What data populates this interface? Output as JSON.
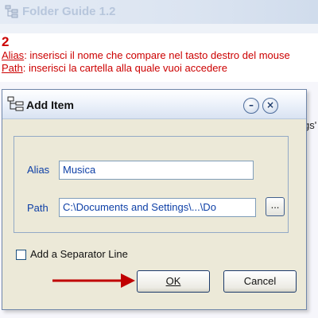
{
  "app": {
    "title": "Folder Guide 1.2"
  },
  "instructions": {
    "step": "2",
    "alias_term": "Alias",
    "alias_text": ": inserisci il nome che compare nel tasto destro del mouse",
    "path_term": "Path",
    "path_text": ": inserisci la cartella alla quale vuoi accedere"
  },
  "background": {
    "clipped_text": "gs'"
  },
  "dialog": {
    "title": "Add Item",
    "alias_label": "Alias",
    "alias_value": "Musica",
    "path_label": "Path",
    "path_value": "C:\\Documents and Settings\\...\\Do",
    "browse_label": "...",
    "separator_label": "Add a Separator Line",
    "separator_checked": false,
    "ok_label": "OK",
    "cancel_label": "Cancel"
  },
  "icons": {
    "app": "folder-tree-icon",
    "dialog": "folder-tree-icon",
    "minimize": "minimize-icon",
    "close": "close-icon",
    "annotation": "red-arrow-icon"
  },
  "colors": {
    "instruction_text": "#cc0000",
    "field_text": "#0d3fa6",
    "arrow": "#c00000",
    "dialog_bg": "#ece9d8"
  }
}
